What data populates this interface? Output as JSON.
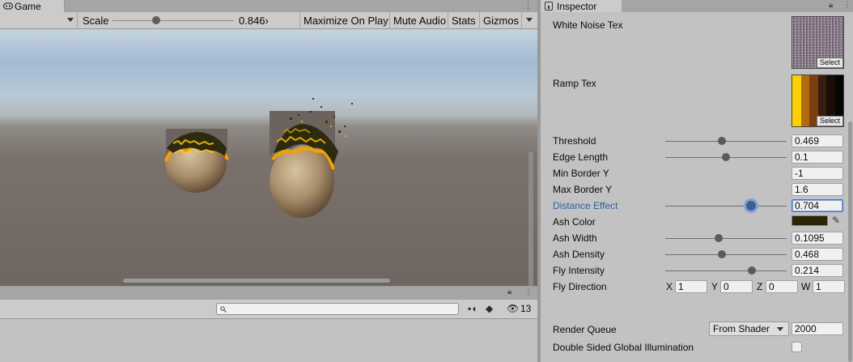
{
  "game": {
    "tab_label": "Game",
    "scale_label": "Scale",
    "scale_value": "0.846›",
    "scale_fraction": 0.36,
    "maximize_label": "Maximize On Play",
    "mute_label": "Mute Audio",
    "stats_label": "Stats",
    "gizmos_label": "Gizmos"
  },
  "console": {
    "search_placeholder": "",
    "hidden_count": "13"
  },
  "inspector": {
    "tab_label": "Inspector",
    "white_noise_label": "White Noise Tex",
    "ramp_label": "Ramp Tex",
    "select_label": "Select",
    "ramp_colors": [
      "#fcd000",
      "#b06a10",
      "#7a3e10",
      "#3a1c10",
      "#1a0c06",
      "#050505"
    ],
    "properties": [
      {
        "label": "Threshold",
        "value": "0.469",
        "slider": 0.469
      },
      {
        "label": "Edge Length",
        "value": "0.1",
        "slider": 0.5
      },
      {
        "label": "Min Border Y",
        "value": "-1"
      },
      {
        "label": "Max Border Y",
        "value": "1.6"
      },
      {
        "label": "Distance Effect",
        "value": "0.704",
        "slider": 0.704,
        "active": true
      },
      {
        "label": "Ash Color",
        "color": "#2a2305"
      },
      {
        "label": "Ash Width",
        "value": "0.1095",
        "slider": 0.44
      },
      {
        "label": "Ash Density",
        "value": "0.468",
        "slider": 0.468
      },
      {
        "label": "Fly Intensity",
        "value": "0.214",
        "slider": 0.71
      },
      {
        "label": "Fly Direction",
        "x_label": "X",
        "x": "1",
        "y_label": "Y",
        "y": "0",
        "z_label": "Z",
        "z": "0",
        "w_label": "W",
        "w": "1"
      }
    ],
    "render_queue_label": "Render Queue",
    "render_queue_mode": "From Shader",
    "render_queue_value": "2000",
    "dsgi_label": "Double Sided Global Illumination"
  }
}
